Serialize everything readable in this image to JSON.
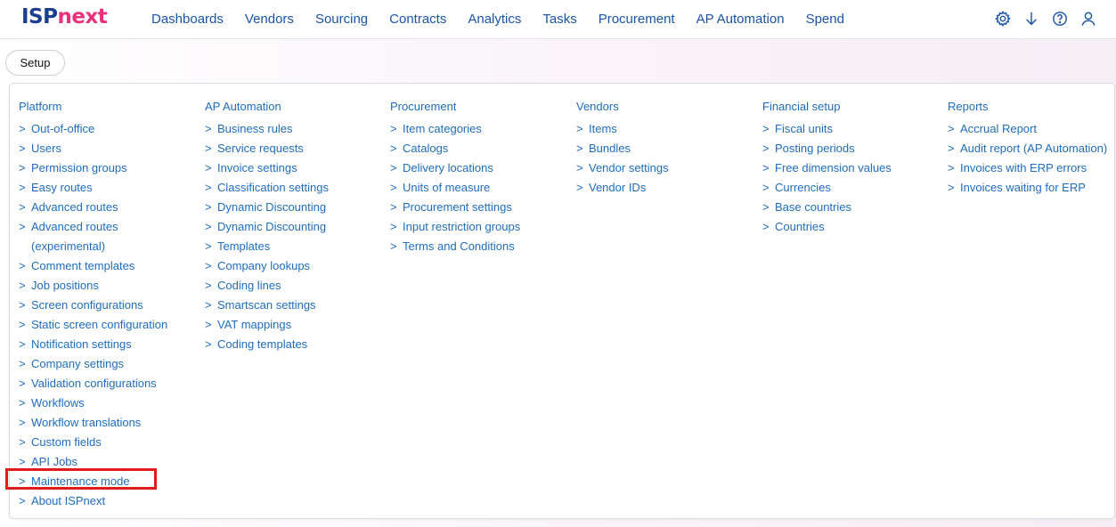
{
  "brand": {
    "part1": "ISP",
    "part2": "next"
  },
  "nav": [
    "Dashboards",
    "Vendors",
    "Sourcing",
    "Contracts",
    "Analytics",
    "Tasks",
    "Procurement",
    "AP Automation",
    "Spend"
  ],
  "toolbar_icons": [
    "gear-icon",
    "download-arrow-icon",
    "help-icon",
    "user-icon"
  ],
  "tab": {
    "label": "Setup"
  },
  "chevron": ">",
  "columns": [
    {
      "title": "Platform",
      "items": [
        "Out-of-office",
        "Users",
        "Permission groups",
        "Easy routes",
        "Advanced routes",
        "Advanced routes (experimental)",
        "Comment templates",
        "Job positions",
        "Screen configurations",
        "Static screen configuration",
        "Notification settings",
        "Company settings",
        "Validation configurations",
        "Workflows",
        "Workflow translations",
        "Custom fields",
        "API Jobs",
        "Maintenance mode",
        "About ISPnext"
      ]
    },
    {
      "title": "AP Automation",
      "items": [
        "Business rules",
        "Service requests",
        "Invoice settings",
        "Classification settings",
        "Dynamic Discounting",
        "Dynamic Discounting",
        "Templates",
        "Company lookups",
        "Coding lines",
        "Smartscan settings",
        "VAT mappings",
        "Coding templates"
      ]
    },
    {
      "title": "Procurement",
      "items": [
        "Item categories",
        "Catalogs",
        "Delivery locations",
        "Units of measure",
        "Procurement settings",
        "Input restriction groups",
        "Terms and Conditions"
      ]
    },
    {
      "title": "Vendors",
      "items": [
        "Items",
        "Bundles",
        "Vendor settings",
        "Vendor IDs"
      ]
    },
    {
      "title": "Financial setup",
      "items": [
        "Fiscal units",
        "Posting periods",
        "Free dimension values",
        "Currencies",
        "Base countries",
        "Countries"
      ]
    },
    {
      "title": "Reports",
      "items": [
        "Accrual Report",
        "Audit report (AP Automation)",
        "Invoices with ERP errors",
        "Invoices waiting for ERP"
      ]
    }
  ],
  "highlight_color": "#e01b1b"
}
